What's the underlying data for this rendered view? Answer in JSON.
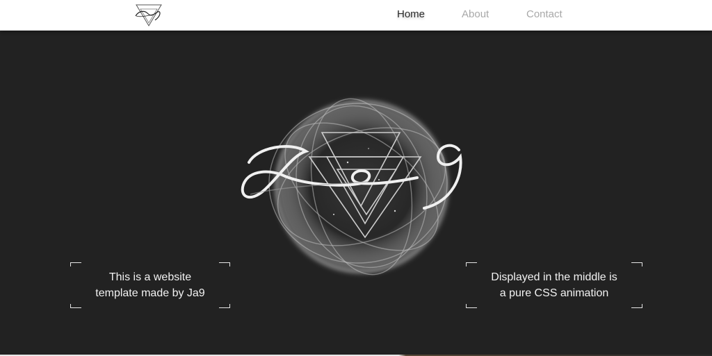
{
  "header": {
    "logo_icon": "ja9-logo-icon",
    "nav": [
      {
        "label": "Home",
        "active": true
      },
      {
        "label": "About",
        "active": false
      },
      {
        "label": "Contact",
        "active": false
      }
    ]
  },
  "hero": {
    "emblem_icon": "ja9-animated-emblem",
    "left_box": {
      "line1": "This is a website",
      "line2": "template made by Ja9"
    },
    "right_box": {
      "line1": "Displayed in the middle is",
      "line2": "a pure CSS animation"
    }
  },
  "colors": {
    "header_bg": "#ffffff",
    "hero_bg": "#222222",
    "nav_active": "#2a2a2a",
    "nav_inactive": "#a8a8a8",
    "text_light": "#f2f2f2"
  }
}
